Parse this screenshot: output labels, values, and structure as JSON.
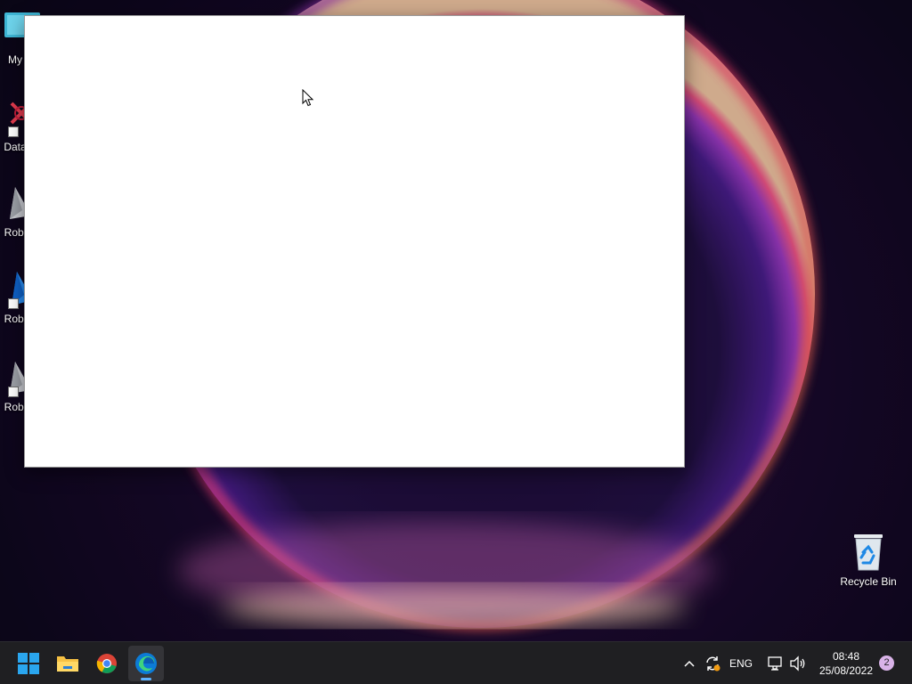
{
  "desktop": {
    "icons": [
      {
        "label": "My C"
      },
      {
        "label": "Data"
      },
      {
        "label": "Robl"
      },
      {
        "label": "Robl"
      },
      {
        "label": "Robl"
      },
      {
        "label": "Recycle Bin"
      }
    ]
  },
  "taskbar": {
    "apps": [
      {
        "name": "start-icon"
      },
      {
        "name": "file-explorer-icon"
      },
      {
        "name": "chrome-icon"
      },
      {
        "name": "edge-icon"
      }
    ],
    "tray": {
      "language": "ENG",
      "time": "08:48",
      "date": "25/08/2022",
      "notification_count": "2"
    }
  },
  "colors": {
    "taskbar_bg": "#1f1f22",
    "window_bg": "#ffffff",
    "accent": "#5db2ff"
  }
}
